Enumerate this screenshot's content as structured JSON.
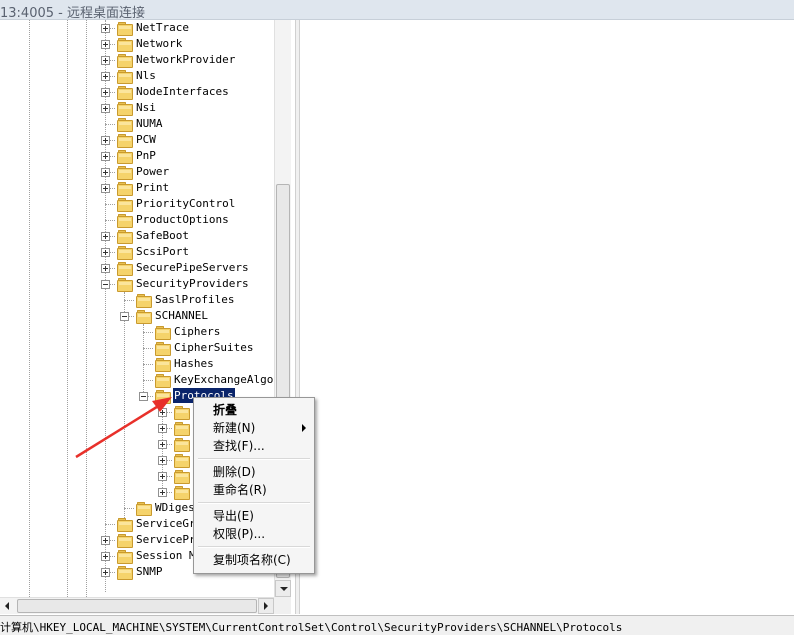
{
  "window": {
    "title": "13:4005 - 远程桌面连接"
  },
  "tree": {
    "items": [
      {
        "label": "NetTrace"
      },
      {
        "label": "Network"
      },
      {
        "label": "NetworkProvider"
      },
      {
        "label": "Nls"
      },
      {
        "label": "NodeInterfaces"
      },
      {
        "label": "Nsi"
      },
      {
        "label": "NUMA"
      },
      {
        "label": "PCW"
      },
      {
        "label": "PnP"
      },
      {
        "label": "Power"
      },
      {
        "label": "Print"
      },
      {
        "label": "PriorityControl"
      },
      {
        "label": "ProductOptions"
      },
      {
        "label": "SafeBoot"
      },
      {
        "label": "ScsiPort"
      },
      {
        "label": "SecurePipeServers"
      },
      {
        "label": "SecurityProviders"
      },
      {
        "label": "SaslProfiles"
      },
      {
        "label": "SCHANNEL"
      },
      {
        "label": "Ciphers"
      },
      {
        "label": "CipherSuites"
      },
      {
        "label": "Hashes"
      },
      {
        "label": "KeyExchangeAlgori"
      },
      {
        "label": "Protocols",
        "selected": true
      },
      {
        "label": ""
      },
      {
        "label": ""
      },
      {
        "label": ""
      },
      {
        "label": ""
      },
      {
        "label": ""
      },
      {
        "label": ""
      },
      {
        "label": "WDiges"
      },
      {
        "label": "ServiceGr"
      },
      {
        "label": "ServicePr"
      },
      {
        "label": "Session Manager"
      },
      {
        "label": "SNMP"
      }
    ]
  },
  "context_menu": {
    "items": [
      {
        "label": "折叠",
        "bold": true
      },
      {
        "label": "新建(N)",
        "submenu": true
      },
      {
        "label": "查找(F)..."
      },
      {
        "label": "删除(D)"
      },
      {
        "label": "重命名(R)"
      },
      {
        "label": "导出(E)"
      },
      {
        "label": "权限(P)..."
      },
      {
        "label": "复制项名称(C)"
      }
    ]
  },
  "statusbar": {
    "path": "计算机\\HKEY_LOCAL_MACHINE\\SYSTEM\\CurrentControlSet\\Control\\SecurityProviders\\SCHANNEL\\Protocols"
  },
  "colors": {
    "selection": "#0a246a",
    "annotation_arrow": "#e8302a",
    "folder": "#f5d36b"
  }
}
